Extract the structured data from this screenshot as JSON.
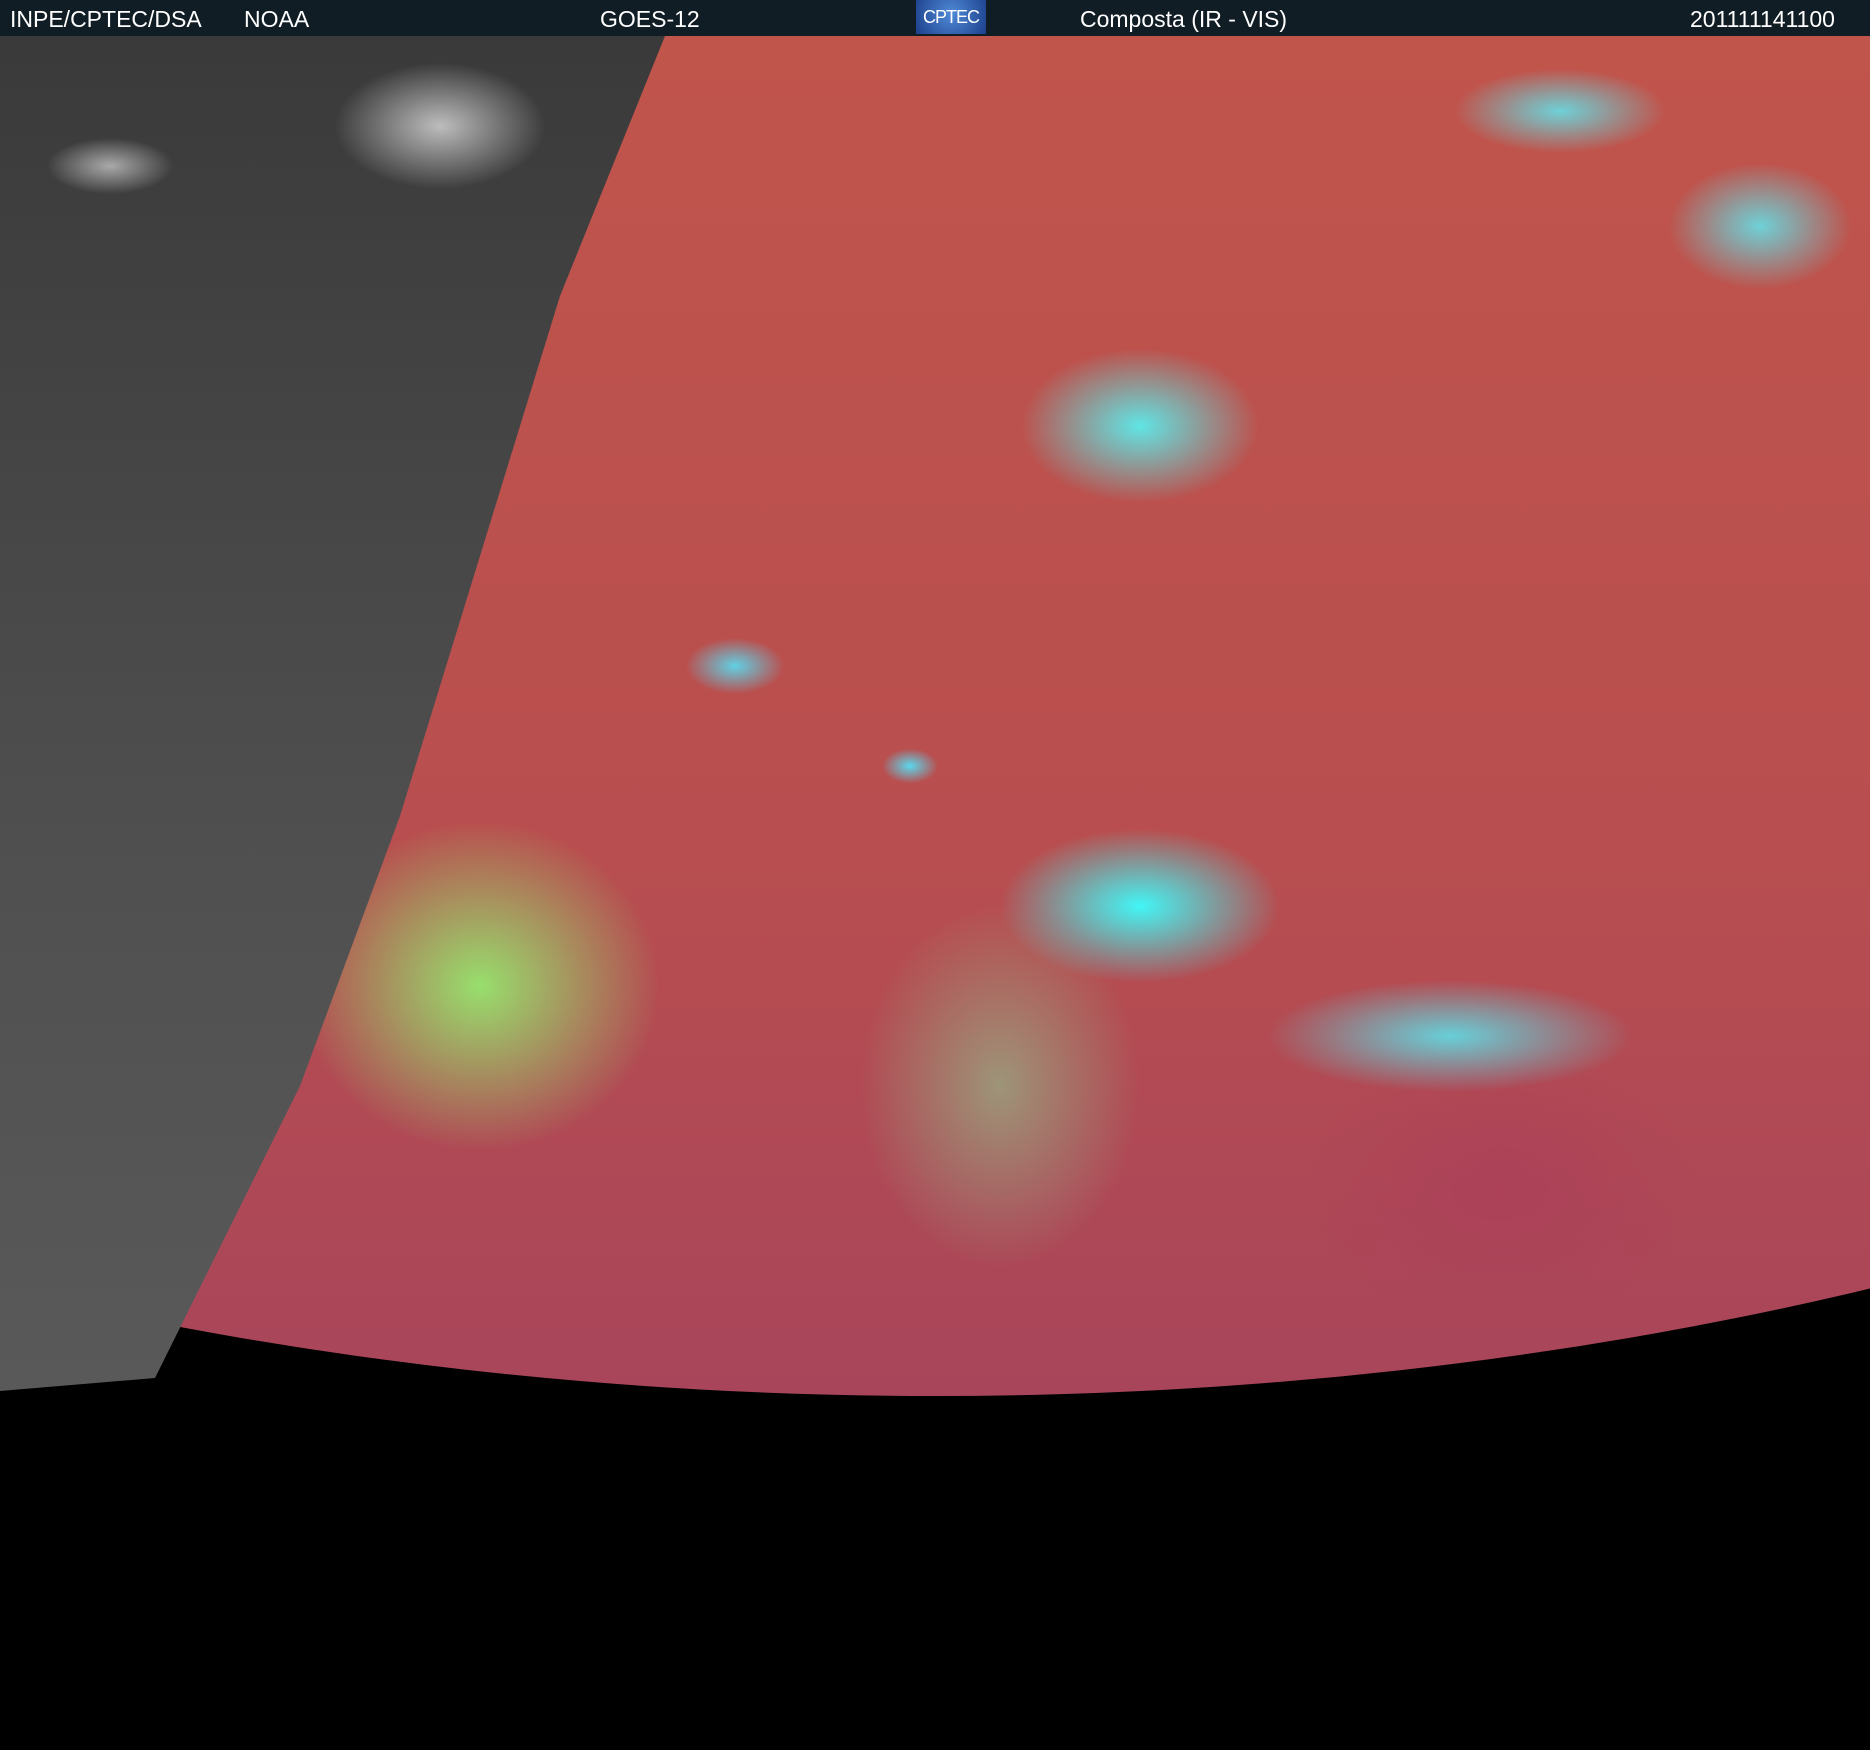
{
  "header": {
    "source": "INPE/CPTEC/DSA",
    "agency": "NOAA",
    "satellite": "GOES-12",
    "logo_text": "CPTEC",
    "product": "Composta (IR - VIS)",
    "timestamp": "201111141100"
  }
}
